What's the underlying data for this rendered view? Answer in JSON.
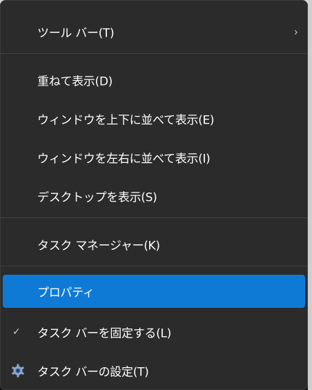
{
  "menu": {
    "items": {
      "toolbar": "ツール バー(T)",
      "cascade": "重ねて表示(D)",
      "stack": "ウィンドウを上下に並べて表示(E)",
      "side_by_side": "ウィンドウを左右に並べて表示(I)",
      "show_desktop": "デスクトップを表示(S)",
      "task_manager": "タスク マネージャー(K)",
      "properties": "プロパティ",
      "lock_taskbar": "タスク バーを固定する(L)",
      "taskbar_settings": "タスク バーの設定(T)"
    },
    "icons": {
      "submenu": "chevron-right-icon",
      "lock_checked": "checkmark-icon",
      "settings": "gear-icon"
    },
    "highlighted_item": "properties",
    "accent_color": "#0f7ad6"
  }
}
